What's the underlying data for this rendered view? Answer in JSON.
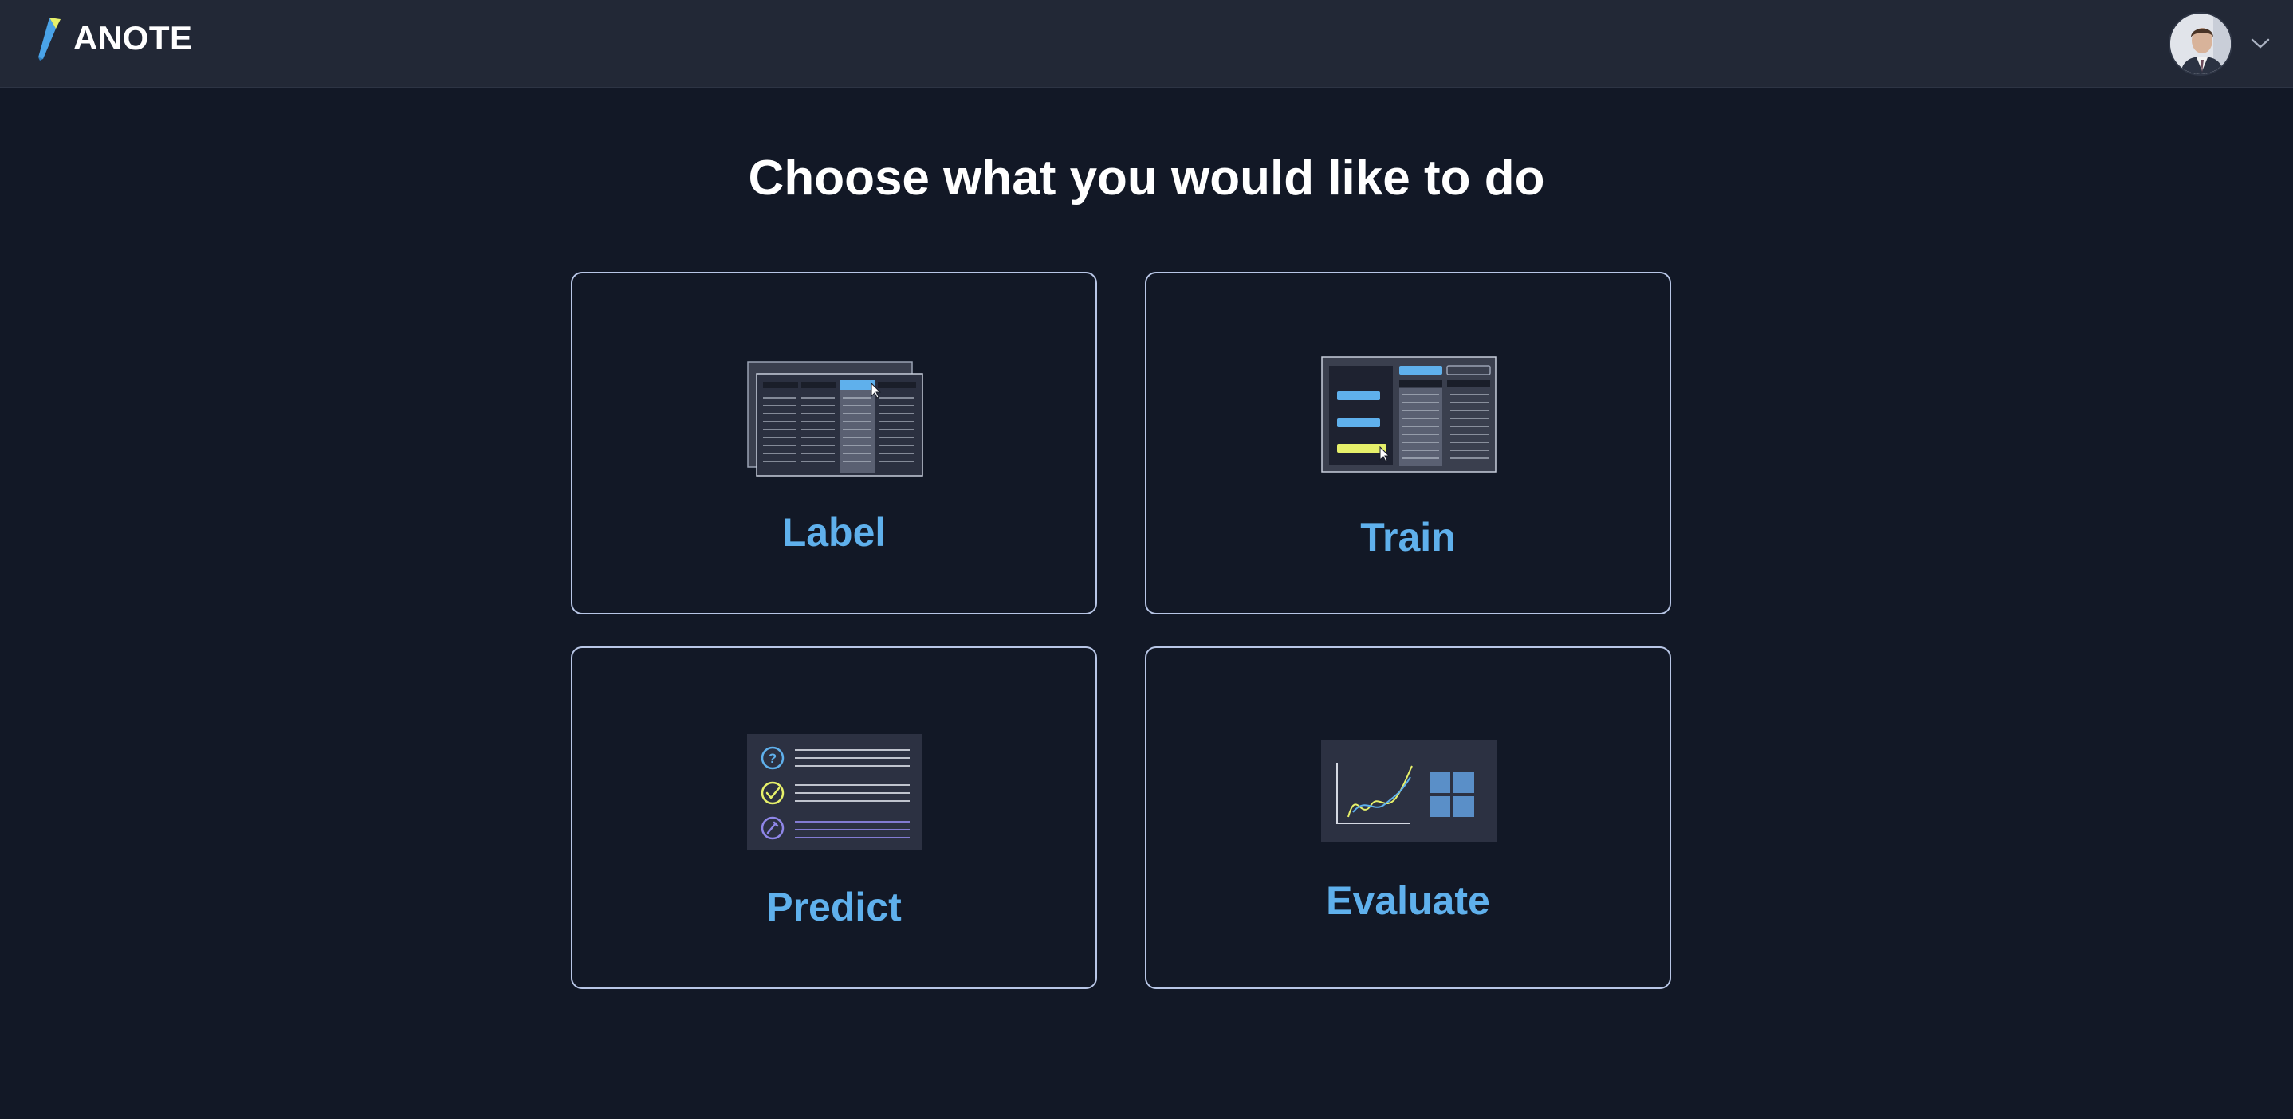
{
  "header": {
    "brand": "ANOTE",
    "logo_icon": "quill-logo-icon",
    "avatar_icon": "user-avatar",
    "menu_icon": "chevron-down-icon"
  },
  "main": {
    "title": "Choose what you would like to do",
    "cards": [
      {
        "id": "label",
        "label": "Label",
        "icon": "spreadsheet-label-icon"
      },
      {
        "id": "train",
        "label": "Train",
        "icon": "train-table-icon"
      },
      {
        "id": "predict",
        "label": "Predict",
        "icon": "predict-list-icon"
      },
      {
        "id": "evaluate",
        "label": "Evaluate",
        "icon": "evaluate-chart-icon"
      }
    ]
  },
  "colors": {
    "background": "#121826",
    "header": "#222836",
    "card_border": "#b8c6e6",
    "accent_blue": "#5fb0ec",
    "accent_yellow": "#e6f06a",
    "accent_purple": "#8f86e8"
  }
}
